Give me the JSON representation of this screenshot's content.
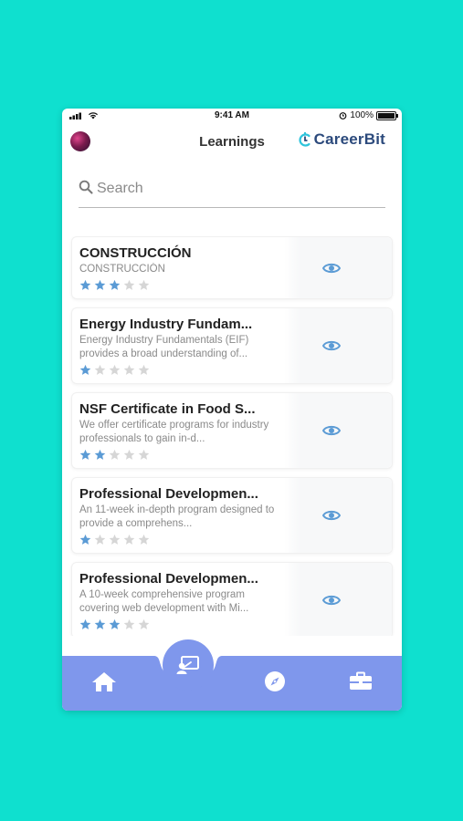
{
  "status_bar": {
    "time": "9:41 AM",
    "battery": "100%"
  },
  "header": {
    "title": "Learnings",
    "brand": "CareerBit"
  },
  "search": {
    "placeholder": "Search"
  },
  "courses": [
    {
      "title": "CONSTRUCCIÓN",
      "description": "CONSTRUCCIÓN",
      "rating": 3
    },
    {
      "title": "Energy Industry Fundam...",
      "description": "Energy Industry Fundamentals (EIF) provides a broad understanding of...",
      "rating": 1
    },
    {
      "title": "NSF Certificate in Food S...",
      "description": "We offer certificate programs for industry professionals to gain in-d...",
      "rating": 2
    },
    {
      "title": "Professional Developmen...",
      "description": "An 11-week in-depth program designed to provide a comprehens...",
      "rating": 1
    },
    {
      "title": "Professional Developmen...",
      "description": "A 10-week comprehensive program covering web development with Mi...",
      "rating": 3
    }
  ],
  "tabs": {
    "home": "home-icon",
    "learnings": "learnings-icon",
    "explore": "compass-icon",
    "jobs": "briefcase-icon"
  },
  "colors": {
    "background": "#0fe0cf",
    "accent": "#7f97ec",
    "star_filled": "#5b9bd5",
    "star_empty": "#d6d6d6",
    "eye": "#5b9bd5",
    "brand": "#2c4a7c"
  }
}
